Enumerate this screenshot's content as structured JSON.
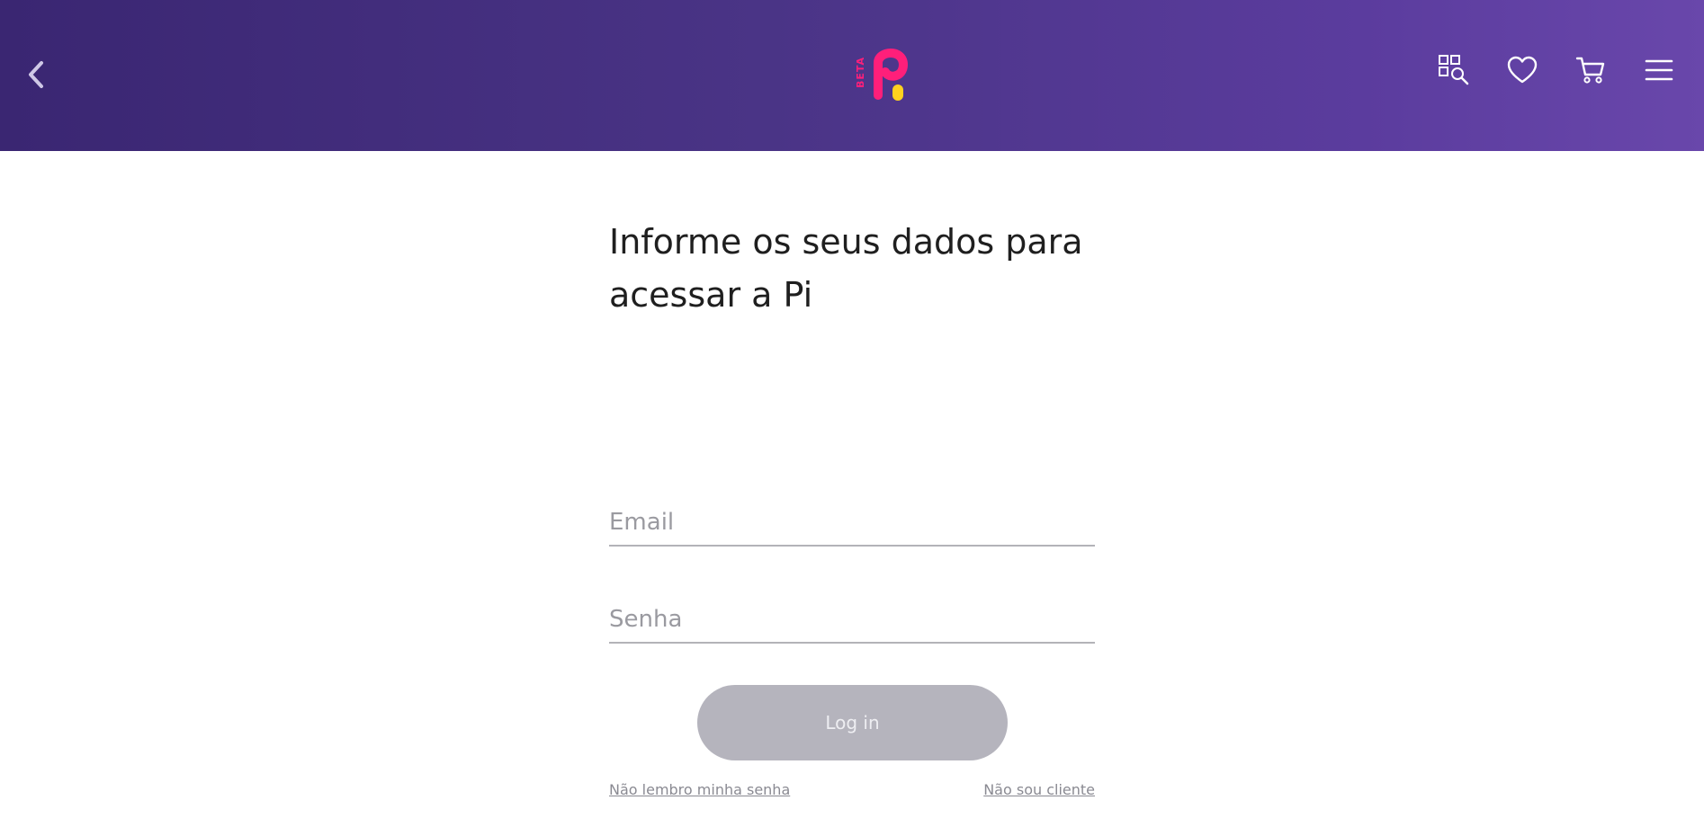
{
  "header": {
    "logo_text": "BETA",
    "back_icon": "chevron-left-icon",
    "icons": [
      "category-search-icon",
      "heart-icon",
      "cart-icon",
      "menu-icon"
    ]
  },
  "main": {
    "title": "Informe os seus dados para acessar a Pi"
  },
  "form": {
    "email_placeholder": "Email",
    "password_placeholder": "Senha",
    "login_label": "Log in",
    "forgot_password": "Não lembro minha senha",
    "not_client": "Não sou cliente"
  },
  "colors": {
    "header_start": "#3a2672",
    "header_end": "#6947ab",
    "logo_pink": "#ff1f7a",
    "logo_yellow": "#ffd21f",
    "button_disabled": "#b5b4bd"
  }
}
